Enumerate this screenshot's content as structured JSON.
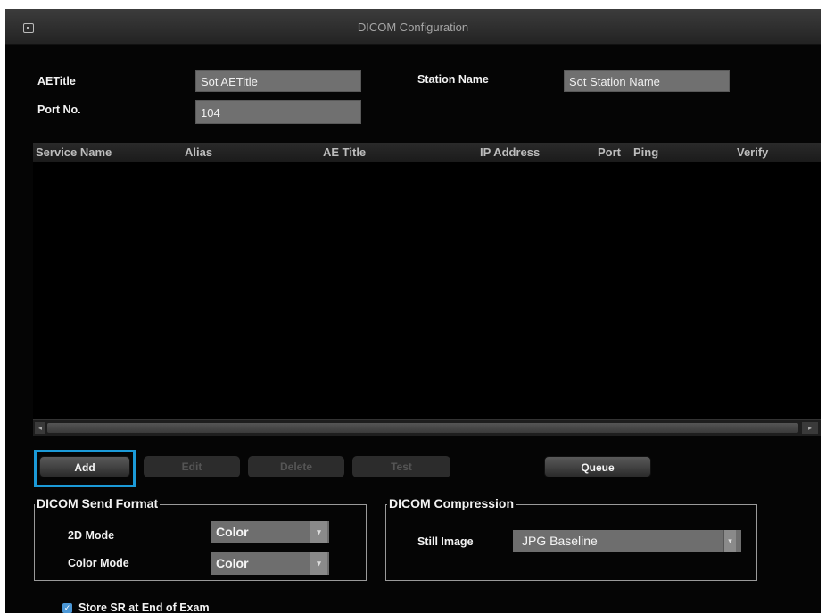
{
  "window": {
    "title": "DICOM Configuration",
    "icon": "system-menu-icon"
  },
  "settings": {
    "aetitle_label": "AETitle",
    "aetitle_value": "Sot AETitle",
    "station_label": "Station Name",
    "station_value": "Sot Station Name",
    "port_label": "Port No.",
    "port_value": "104"
  },
  "table": {
    "columns": [
      "Service Name",
      "Alias",
      "AE Title",
      "IP Address",
      "Port",
      "Ping",
      "Verify"
    ],
    "rows": []
  },
  "buttons": {
    "add": "Add",
    "edit": "Edit",
    "delete": "Delete",
    "test": "Test",
    "queue": "Queue"
  },
  "send_format": {
    "title": "DICOM Send Format",
    "mode2d_label": "2D Mode",
    "mode2d_value": "Color",
    "colormode_label": "Color Mode",
    "colormode_value": "Color"
  },
  "compression": {
    "title": "DICOM Compression",
    "still_label": "Still Image",
    "still_value": "JPG Baseline"
  },
  "store_sr": {
    "label": "Store SR at End of Exam",
    "checked": true
  },
  "colors": {
    "focus": "#1b9ad8",
    "field": "#707070",
    "background": "#050505"
  }
}
